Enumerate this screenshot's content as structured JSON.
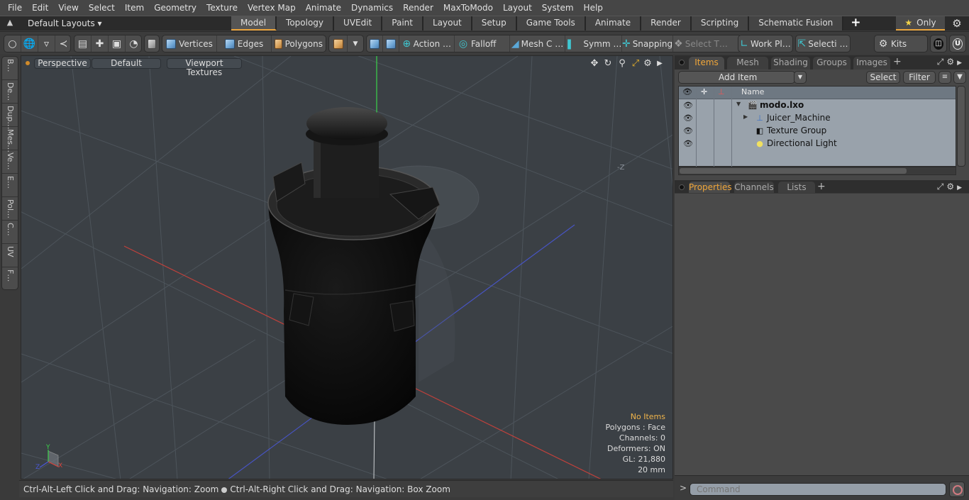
{
  "menu": [
    "File",
    "Edit",
    "View",
    "Select",
    "Item",
    "Geometry",
    "Texture",
    "Vertex Map",
    "Animate",
    "Dynamics",
    "Render",
    "MaxToModo",
    "Layout",
    "System",
    "Help"
  ],
  "layout": {
    "preset_label": "Default Layouts ▾",
    "tabs": [
      "Model",
      "Topology",
      "UVEdit",
      "Paint",
      "Layout",
      "Setup",
      "Game Tools",
      "Animate",
      "Render",
      "Scripting",
      "Schematic Fusion"
    ],
    "active_tab": "Model",
    "add_tab": "+",
    "only_label": "Only"
  },
  "toolbar": {
    "vertices": "Vertices",
    "edges": "Edges",
    "polygons": "Polygons",
    "action": "Action …",
    "falloff": "Falloff",
    "mesh_c": "Mesh C …",
    "symm": "Symm …",
    "snapping": "Snapping",
    "select_t": "Select T…",
    "work_pl": "Work Pl…",
    "selecti": "Selecti …",
    "kits": "Kits"
  },
  "left_tabs": [
    "B…",
    "De…",
    "Dup…",
    "Mes…",
    "Ve…",
    "E…",
    "Pol…",
    "C…",
    "UV",
    "F…"
  ],
  "viewport": {
    "view_mode": "Perspective",
    "shading": "Default",
    "textures": "Viewport Textures",
    "axis_label_z": "-Z",
    "info": {
      "selection": "No Items",
      "polygons": "Polygons : Face",
      "channels": "Channels: 0",
      "deformers": "Deformers: ON",
      "gl": "GL: 21,880",
      "unit": "20 mm"
    },
    "gizmo": {
      "y": "Y",
      "z": "Z",
      "x": "X"
    }
  },
  "status": {
    "hint_left": "Ctrl-Alt-Left Click and Drag: Navigation: Zoom",
    "hint_right": "Ctrl-Alt-Right Click and Drag: Navigation: Box Zoom"
  },
  "items_panel": {
    "tabs": [
      "Items",
      "Mesh Ops",
      "Shading",
      "Groups",
      "Images"
    ],
    "active_tab": "Items",
    "add_item": "Add Item",
    "select": "Select",
    "filter": "Filter",
    "column_name": "Name",
    "rows": [
      {
        "name": "modo.lxo",
        "icon": "scene-icon",
        "bold": true
      },
      {
        "name": "Juicer_Machine",
        "icon": "locator-icon",
        "bold": false
      },
      {
        "name": "Texture Group",
        "icon": "texture-group-icon",
        "bold": false
      },
      {
        "name": "Directional Light",
        "icon": "light-icon",
        "bold": false
      }
    ]
  },
  "properties_panel": {
    "tabs": [
      "Properties",
      "Channels",
      "Lists"
    ],
    "active_tab": "Properties"
  },
  "command": {
    "prompt": ">",
    "placeholder": "Command"
  },
  "colors": {
    "accent": "#e8a33c",
    "active_tab_text": "#f0a63a",
    "viewport_bg": "#3b4045",
    "axis_x": "#d8413a",
    "axis_y": "#3bd24a",
    "axis_z": "#3a4ad8"
  }
}
